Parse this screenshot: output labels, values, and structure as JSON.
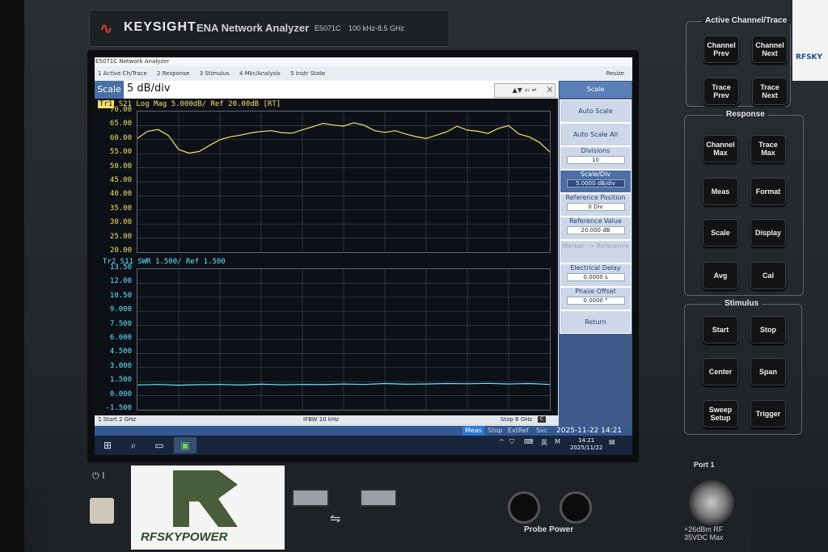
{
  "instrument": {
    "brand": "KEYSIGHT",
    "product": "ENA Network Analyzer",
    "model": "E5071C",
    "range": "100 kHz-8.5 GHz"
  },
  "window": {
    "title": "E5071C Network Analyzer",
    "resize_label": "Resize",
    "menu": [
      "1 Active Ch/Trace",
      "2 Response",
      "3 Stimulus",
      "4 Mkr/Analysis",
      "5 Instr State"
    ]
  },
  "entry": {
    "label": "Scale",
    "value": "5 dB/div"
  },
  "softkeys": {
    "header": "Scale",
    "items": [
      {
        "label": "Auto Scale",
        "value": ""
      },
      {
        "label": "Auto Scale All",
        "value": ""
      },
      {
        "label": "Divisions",
        "value": "10"
      },
      {
        "label": "Scale/Div",
        "value": "5.0000 dB/div"
      },
      {
        "label": "Reference Position",
        "value": "0 Div"
      },
      {
        "label": "Reference Value",
        "value": "20.000 dB"
      },
      {
        "label": "Marker -> Reference",
        "value": ""
      },
      {
        "label": "Electrical Delay",
        "value": "0.0000 s"
      },
      {
        "label": "Phase Offset",
        "value": "0.0000 °"
      },
      {
        "label": "Return",
        "value": ""
      }
    ]
  },
  "status": {
    "start": "1  Start 2 GHz",
    "ifbw": "IFBW 10 kHz",
    "stop": "Stop 6 GHz",
    "box": "C"
  },
  "meas_bar": {
    "items": [
      "Meas",
      "Stop",
      "ExtRef",
      "Svc"
    ],
    "datetime": "2025-11-22 14:21"
  },
  "taskbar": {
    "tray_lang": "英",
    "tray_m": "M",
    "time": "14:21",
    "date": "2025/11/22"
  },
  "chart_data": [
    {
      "type": "line",
      "header": "S21  Log Mag 5.000dB/ Ref 20.00dB [RT]",
      "trace_tag": "Tr1",
      "yticks": [
        "70.00",
        "65.00",
        "60.00",
        "55.00",
        "50.00",
        "45.00",
        "40.00",
        "35.00",
        "30.00",
        "25.00",
        "20.00"
      ],
      "ylim": [
        20,
        70
      ],
      "xlim": [
        2,
        6
      ],
      "x_unit": "GHz",
      "color": "#f2e06a",
      "series": [
        {
          "x": [
            2.0,
            2.1,
            2.2,
            2.3,
            2.4,
            2.5,
            2.6,
            2.7,
            2.8,
            2.9,
            3.0,
            3.1,
            3.2,
            3.3,
            3.4,
            3.5,
            3.6,
            3.7,
            3.8,
            3.9,
            4.0,
            4.1,
            4.2,
            4.3,
            4.4,
            4.5,
            4.6,
            4.7,
            4.8,
            4.9,
            5.0,
            5.1,
            5.2,
            5.3,
            5.4,
            5.5,
            5.6,
            5.7,
            5.8,
            5.9,
            6.0
          ],
          "values": [
            60.5,
            63,
            63.6,
            61.5,
            56.5,
            55.2,
            55.8,
            58,
            60,
            61,
            61.6,
            62.4,
            62.9,
            63.2,
            62.5,
            62.3,
            63.5,
            64.6,
            65.8,
            65.2,
            64.8,
            66,
            65.1,
            63.2,
            62.6,
            63.2,
            62,
            61.1,
            60.4,
            61.6,
            62.8,
            64.8,
            63.4,
            63,
            62.2,
            64,
            65,
            62,
            61,
            59,
            55.6
          ]
        }
      ]
    },
    {
      "type": "line",
      "header": "Tr2 S11  SWR 1.500/ Ref 1.500",
      "trace_tag": "Tr2",
      "yticks": [
        "13.50",
        "12.00",
        "10.50",
        "9.000",
        "7.500",
        "6.000",
        "4.500",
        "3.000",
        "1.500",
        "0.000",
        "-1.500"
      ],
      "ylim": [
        -1.5,
        13.5
      ],
      "xlim": [
        2,
        6
      ],
      "x_unit": "GHz",
      "color": "#67e4ff",
      "series": [
        {
          "x": [
            2.0,
            2.2,
            2.4,
            2.6,
            2.8,
            3.0,
            3.2,
            3.4,
            3.6,
            3.8,
            4.0,
            4.2,
            4.4,
            4.6,
            4.8,
            5.0,
            5.2,
            5.4,
            5.6,
            5.8,
            6.0
          ],
          "values": [
            1.15,
            1.2,
            1.12,
            1.18,
            1.2,
            1.14,
            1.22,
            1.16,
            1.2,
            1.18,
            1.24,
            1.2,
            1.3,
            1.22,
            1.25,
            1.3,
            1.28,
            1.32,
            1.25,
            1.3,
            1.2
          ]
        }
      ]
    }
  ],
  "hardkeys": {
    "active_channel_title": "Active Channel/Trace",
    "response_title": "Response",
    "stimulus_title": "Stimulus",
    "active": [
      "Channel\nPrev",
      "Channel\nNext",
      "Trace\nPrev",
      "Trace\nNext"
    ],
    "response": [
      "Channel\nMax",
      "Trace\nMax",
      "Meas",
      "Format",
      "Scale",
      "Display",
      "Avg",
      "Cal"
    ],
    "stimulus": [
      "Start",
      "Stop",
      "Center",
      "Span",
      "Sweep\nSetup",
      "Trigger"
    ]
  },
  "front": {
    "probe_power": "Probe Power",
    "port": "Port 1",
    "port_spec_1": "+26dBm RF",
    "port_spec_2": "35VDC Max",
    "logo": "RFSKYPOWER",
    "sticker": "RFSKY"
  }
}
